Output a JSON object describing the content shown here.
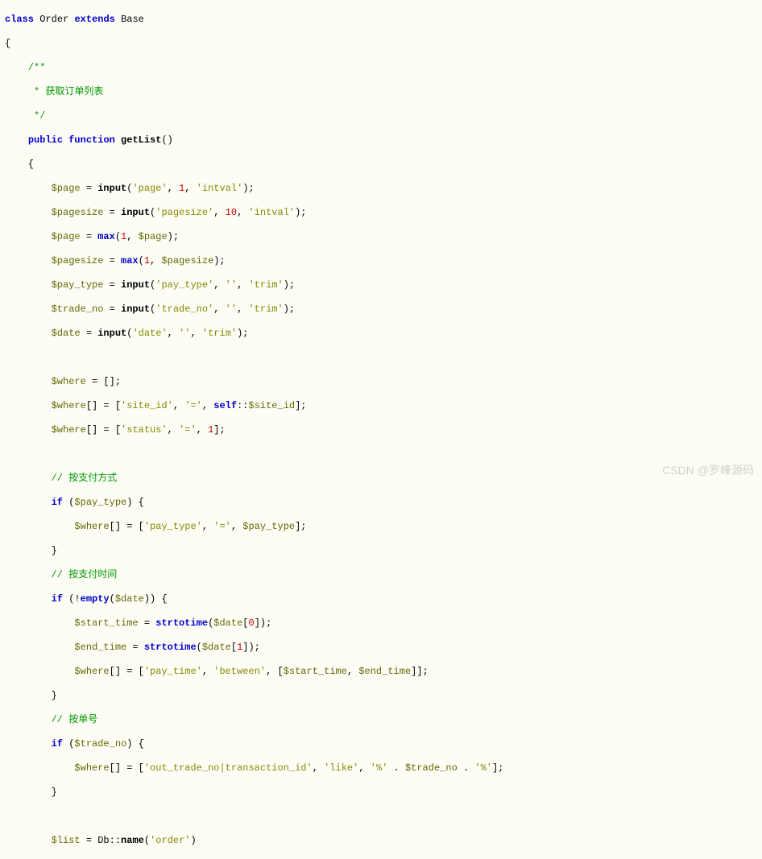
{
  "code": {
    "l1_class": "class",
    "l1_name": "Order",
    "l1_extends": "extends",
    "l1_base": "Base",
    "l2_brace": "{",
    "l3_c": "    /**",
    "l4_c": "     * 获取订单列表",
    "l5_c": "     */",
    "l6_public": "public",
    "l6_function": "function",
    "l6_name": "getList",
    "l6_paren": "()",
    "l7_brace": "    {",
    "l8_var": "$page",
    "l8_eq": " = ",
    "l8_fn": "input",
    "l8_p1": "(",
    "l8_s1": "'page'",
    "l8_c1": ", ",
    "l8_n1": "1",
    "l8_c2": ", ",
    "l8_s2": "'intval'",
    "l8_p2": ");",
    "l9_var": "$pagesize",
    "l9_fn": "input",
    "l9_s1": "'pagesize'",
    "l9_n1": "10",
    "l9_s2": "'intval'",
    "l10_var": "$page",
    "l10_fn": "max",
    "l10_n1": "1",
    "l10_v2": "$page",
    "l11_var": "$pagesize",
    "l11_fn": "max",
    "l11_n1": "1",
    "l11_v2": "$pagesize",
    "l12_var": "$pay_type",
    "l12_fn": "input",
    "l12_s1": "'pay_type'",
    "l12_s2": "''",
    "l12_s3": "'trim'",
    "l13_var": "$trade_no",
    "l13_fn": "input",
    "l13_s1": "'trade_no'",
    "l13_s2": "''",
    "l13_s3": "'trim'",
    "l14_var": "$date",
    "l14_fn": "input",
    "l14_s1": "'date'",
    "l14_s2": "''",
    "l14_s3": "'trim'",
    "l16_var": "$where",
    "l16_val": " = [];",
    "l17_var": "$where",
    "l17_idx": "[]",
    "l17_eq": " = [",
    "l17_s1": "'site_id'",
    "l17_c1": ", ",
    "l17_s2": "'='",
    "l17_c2": ", ",
    "l17_self": "self",
    "l17_sc": "::",
    "l17_sid": "$site_id",
    "l17_end": "];",
    "l18_var": "$where",
    "l18_s1": "'status'",
    "l18_s2": "'='",
    "l18_n1": "1",
    "l20_c": "        // 按支付方式",
    "l21_if": "if",
    "l21_var": "$pay_type",
    "l22_var": "$where",
    "l22_s1": "'pay_type'",
    "l22_s2": "'='",
    "l22_v3": "$pay_type",
    "l24_c": "        // 按支付时间",
    "l25_if": "if",
    "l25_em": "empty",
    "l25_var": "$date",
    "l26_var": "$start_time",
    "l26_fn": "strtotime",
    "l26_v2": "$date",
    "l26_n": "0",
    "l27_var": "$end_time",
    "l27_fn": "strtotime",
    "l27_v2": "$date",
    "l27_n": "1",
    "l28_var": "$where",
    "l28_s1": "'pay_time'",
    "l28_s2": "'between'",
    "l28_v1": "$start_time",
    "l28_v2": "$end_time",
    "l30_c": "        // 按单号",
    "l31_if": "if",
    "l31_var": "$trade_no",
    "l32_var": "$where",
    "l32_s1": "'out_trade_no|transaction_id'",
    "l32_s2": "'like'",
    "l32_s3": "'%'",
    "l32_v": "$trade_no",
    "l32_s4": "'%'",
    "l35_var": "$list",
    "l35_db": "Db",
    "l35_nm": "name",
    "l35_s1": "'order'"
  },
  "watermark": "CSDN @罗峰源码"
}
